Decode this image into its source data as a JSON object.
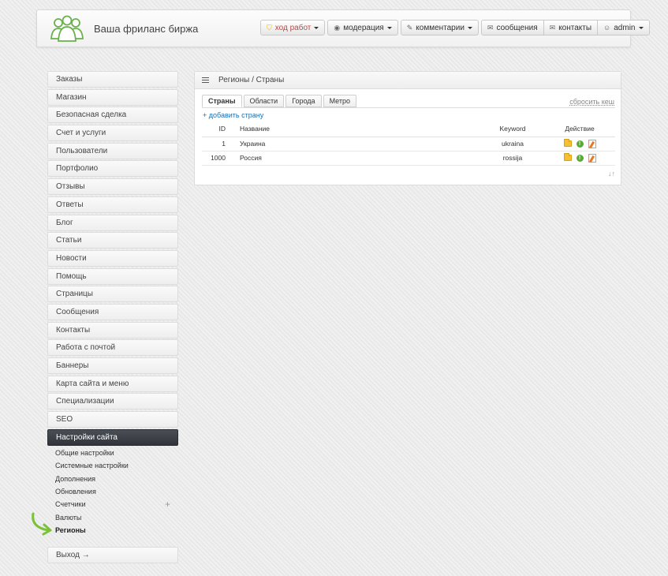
{
  "header": {
    "title": "Ваша фриланс биржа",
    "nav": [
      {
        "label": "ход работ",
        "icon": "shield-icon",
        "dropdown": true,
        "accent": "#b94a48"
      },
      {
        "label": "модерация",
        "icon": "eye-icon",
        "dropdown": true
      },
      {
        "label": "комментарии",
        "icon": "pencil-icon",
        "dropdown": true
      }
    ],
    "nav_group": [
      {
        "label": "сообщения",
        "icon": "envelope-icon"
      },
      {
        "label": "контакты",
        "icon": "envelope-icon"
      },
      {
        "label": "admin",
        "icon": "user-icon",
        "dropdown": true
      }
    ]
  },
  "sidebar": {
    "items": [
      {
        "label": "Заказы"
      },
      {
        "label": "Магазин"
      },
      {
        "label": "Безопасная сделка"
      },
      {
        "label": "Счет и услуги"
      },
      {
        "label": "Пользователи"
      },
      {
        "label": "Портфолио"
      },
      {
        "label": "Отзывы"
      },
      {
        "label": "Ответы"
      },
      {
        "label": "Блог"
      },
      {
        "label": "Статьи"
      },
      {
        "label": "Новости"
      },
      {
        "label": "Помощь"
      },
      {
        "label": "Страницы"
      },
      {
        "label": "Сообщения"
      },
      {
        "label": "Контакты"
      },
      {
        "label": "Работа с почтой"
      },
      {
        "label": "Баннеры"
      },
      {
        "label": "Карта сайта и меню"
      },
      {
        "label": "Специализации"
      },
      {
        "label": "SEO"
      },
      {
        "label": "Настройки сайта"
      }
    ],
    "submenu": [
      {
        "label": "Общие настройки"
      },
      {
        "label": "Системные настройки"
      },
      {
        "label": "Дополнения"
      },
      {
        "label": "Обновления"
      },
      {
        "label": "Счетчики"
      },
      {
        "label": "Валюты"
      },
      {
        "label": "Регионы"
      }
    ],
    "logout": "Выход →"
  },
  "main": {
    "breadcrumb": "Регионы / Страны",
    "tabs": [
      {
        "label": "Страны",
        "active": true
      },
      {
        "label": "Области"
      },
      {
        "label": "Города"
      },
      {
        "label": "Метро"
      }
    ],
    "reset_cache": "сбросить кеш",
    "add_country": "+ добавить страну",
    "table": {
      "headers": {
        "id": "ID",
        "name": "Название",
        "keyword": "Keyword",
        "action": "Действие"
      },
      "rows": [
        {
          "id": "1",
          "name": "Украина",
          "keyword": "ukraina"
        },
        {
          "id": "1000",
          "name": "Россия",
          "keyword": "rossija"
        }
      ]
    },
    "sort_icon": "↓↑"
  },
  "colors": {
    "active_menu": "#30343a",
    "link": "#1a6fb3",
    "accent_nav": "#b94a48",
    "logo_green": "#6ab04c",
    "arrow_green": "#7cc13a"
  }
}
